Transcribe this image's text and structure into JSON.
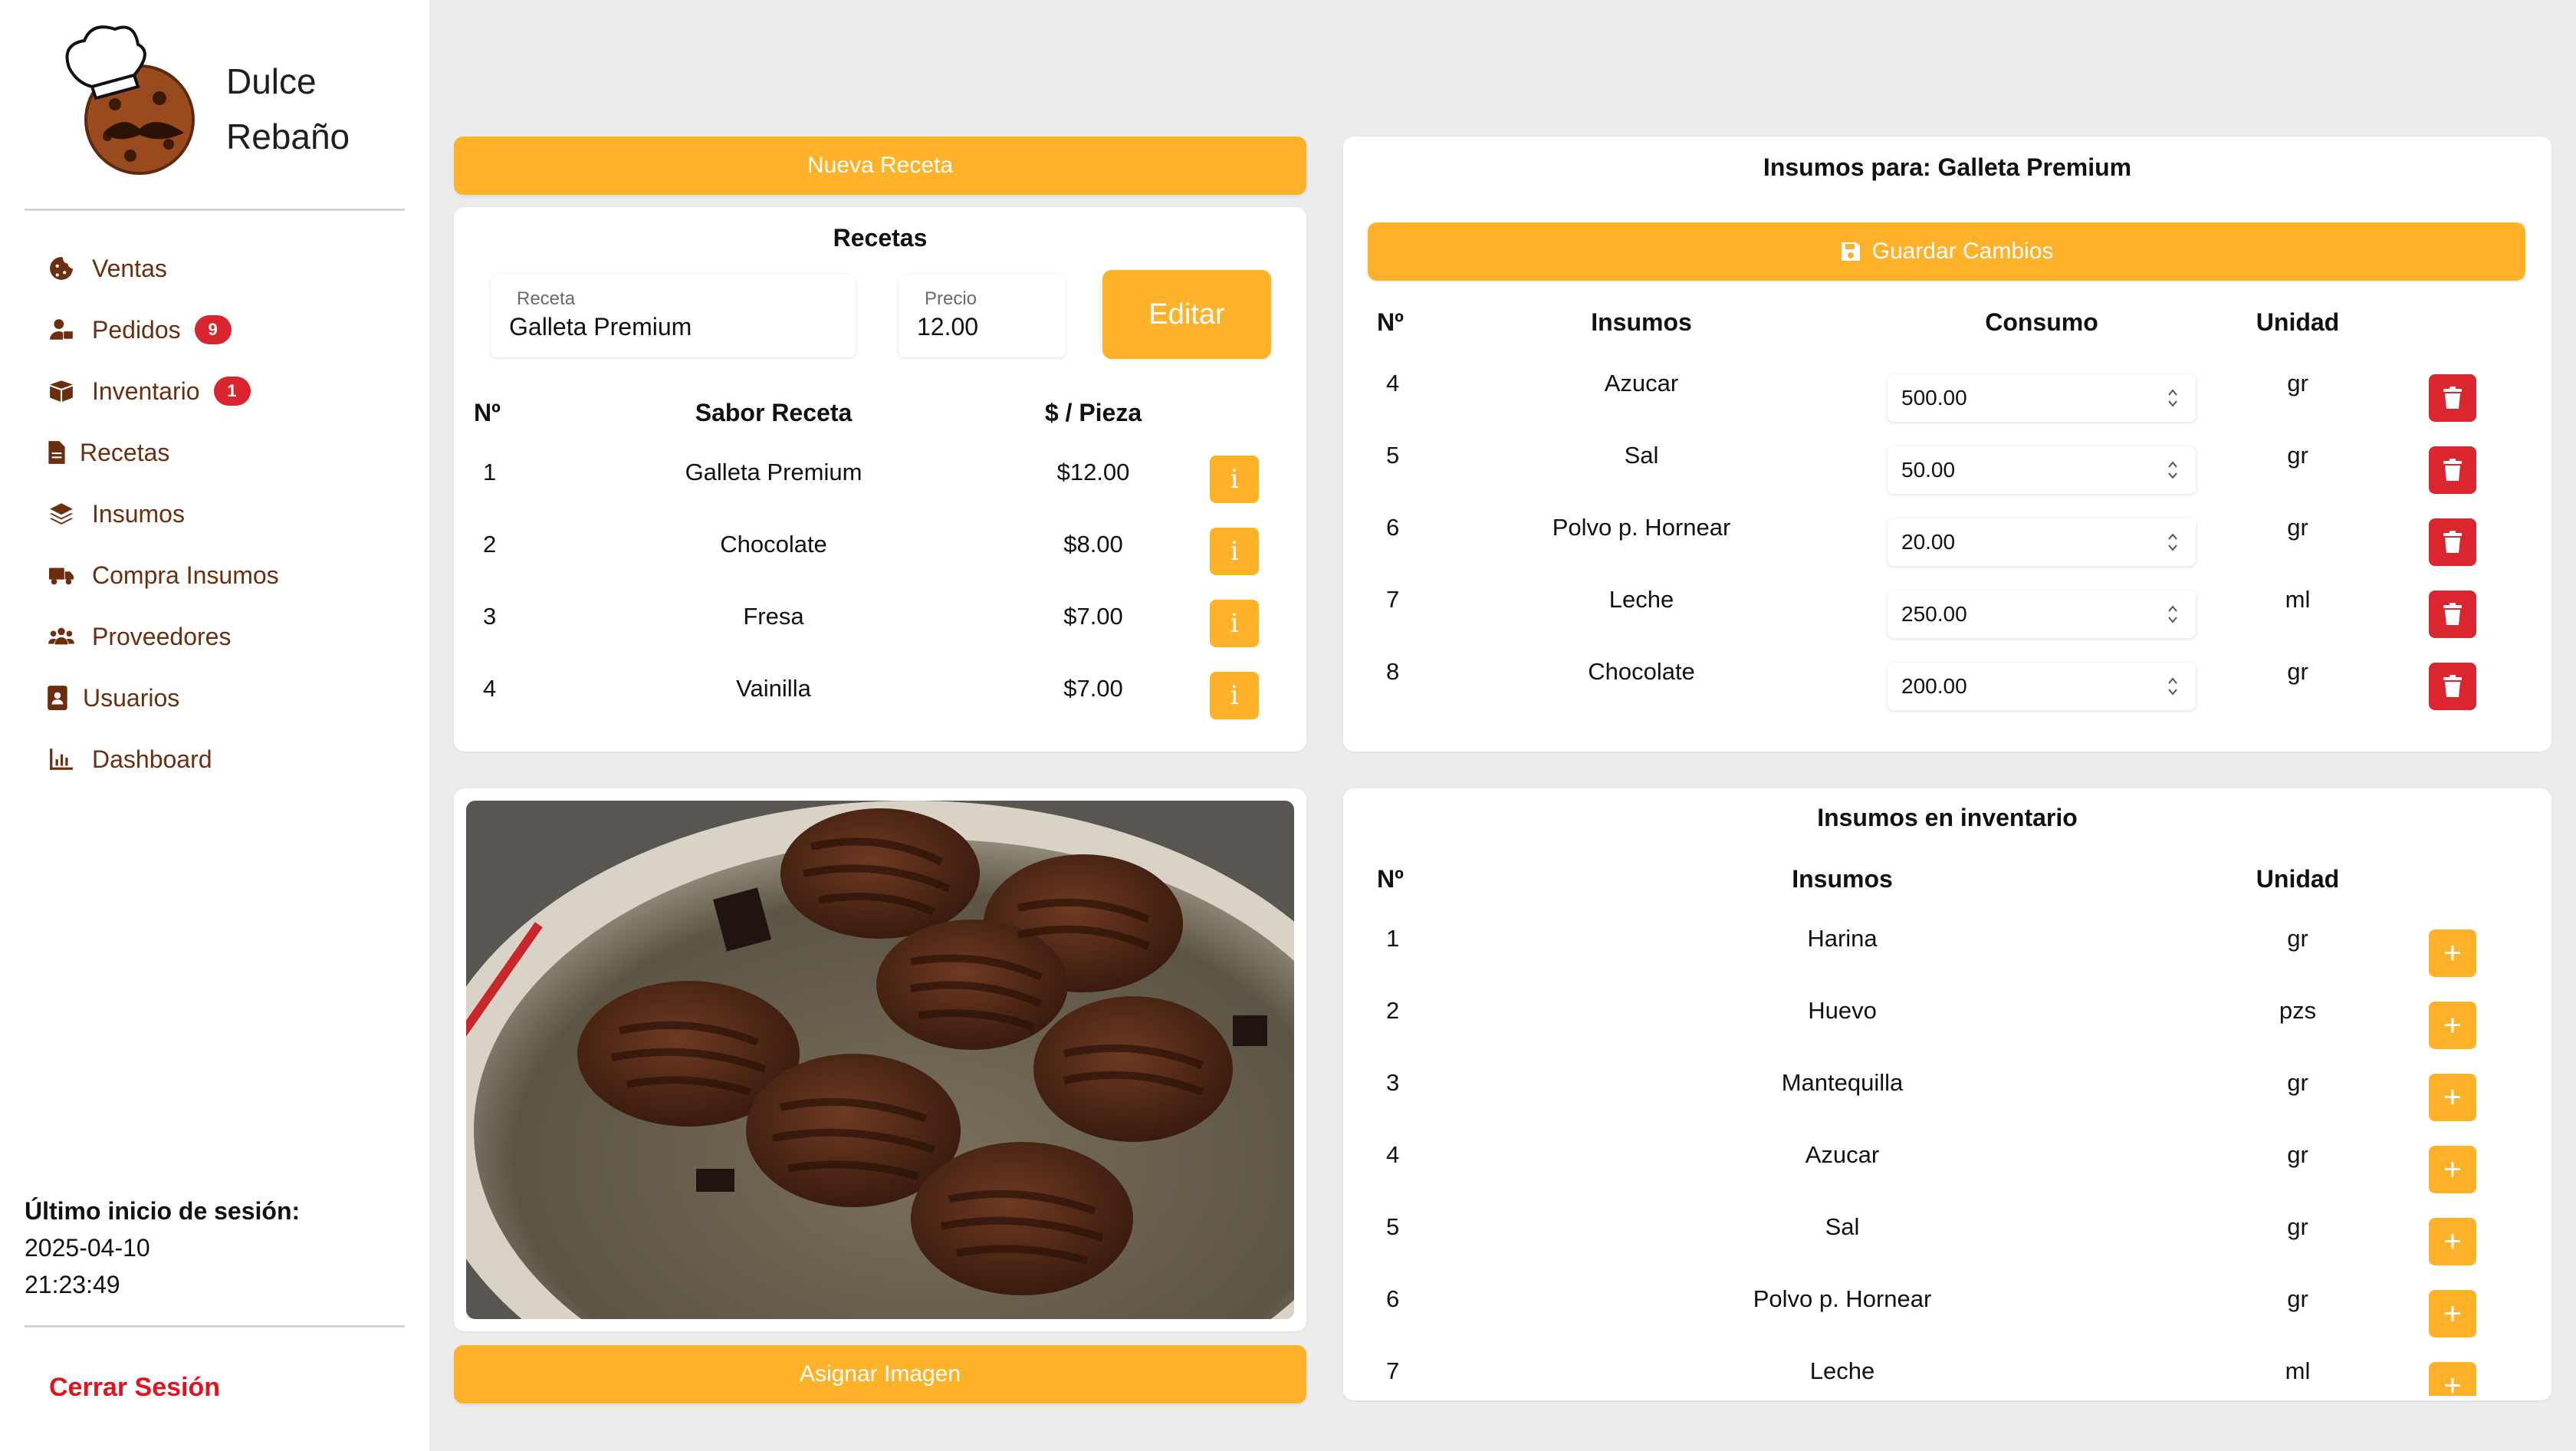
{
  "brand": {
    "line1": "Dulce",
    "line2": "Rebaño"
  },
  "nav": [
    {
      "label": "Ventas",
      "icon": "cookie-icon"
    },
    {
      "label": "Pedidos",
      "icon": "user-delivery-icon",
      "badge": "9"
    },
    {
      "label": "Inventario",
      "icon": "boxes-icon",
      "badge": "1"
    },
    {
      "label": "Recetas",
      "icon": "file-icon"
    },
    {
      "label": "Insumos",
      "icon": "layers-icon"
    },
    {
      "label": "Compra Insumos",
      "icon": "truck-icon"
    },
    {
      "label": "Proveedores",
      "icon": "users-icon"
    },
    {
      "label": "Usuarios",
      "icon": "address-book-icon"
    },
    {
      "label": "Dashboard",
      "icon": "chart-icon"
    }
  ],
  "session": {
    "label": "Último inicio de sesión:",
    "date": "2025-04-10",
    "time": "21:23:49"
  },
  "logout": "Cerrar Sesión",
  "recipes": {
    "new_button": "Nueva Receta",
    "title": "Recetas",
    "field_recipe_label": "Receta",
    "field_recipe_value": "Galleta Premium",
    "field_price_label": "Precio",
    "field_price_value": "12.00",
    "edit_button": "Editar",
    "headers": {
      "num": "Nº",
      "flavor": "Sabor Receta",
      "price": "$ / Pieza"
    },
    "rows": [
      {
        "num": "1",
        "flavor": "Galleta Premium",
        "price": "$12.00"
      },
      {
        "num": "2",
        "flavor": "Chocolate",
        "price": "$8.00"
      },
      {
        "num": "3",
        "flavor": "Fresa",
        "price": "$7.00"
      },
      {
        "num": "4",
        "flavor": "Vainilla",
        "price": "$7.00"
      }
    ],
    "info_label": "i"
  },
  "image_panel": {
    "assign_button": "Asignar Imagen"
  },
  "supplies_for": {
    "title": "Insumos para: Galleta Premium",
    "save_button": "Guardar Cambios",
    "headers": {
      "num": "Nº",
      "supply": "Insumos",
      "consumption": "Consumo",
      "unit": "Unidad"
    },
    "rows": [
      {
        "num": "4",
        "supply": "Azucar",
        "consumption": "500.00",
        "unit": "gr"
      },
      {
        "num": "5",
        "supply": "Sal",
        "consumption": "50.00",
        "unit": "gr"
      },
      {
        "num": "6",
        "supply": "Polvo p. Hornear",
        "consumption": "20.00",
        "unit": "gr"
      },
      {
        "num": "7",
        "supply": "Leche",
        "consumption": "250.00",
        "unit": "ml"
      },
      {
        "num": "8",
        "supply": "Chocolate",
        "consumption": "200.00",
        "unit": "gr"
      }
    ]
  },
  "inventory": {
    "title": "Insumos en inventario",
    "headers": {
      "num": "Nº",
      "supply": "Insumos",
      "unit": "Unidad"
    },
    "rows": [
      {
        "num": "1",
        "supply": "Harina",
        "unit": "gr"
      },
      {
        "num": "2",
        "supply": "Huevo",
        "unit": "pzs"
      },
      {
        "num": "3",
        "supply": "Mantequilla",
        "unit": "gr"
      },
      {
        "num": "4",
        "supply": "Azucar",
        "unit": "gr"
      },
      {
        "num": "5",
        "supply": "Sal",
        "unit": "gr"
      },
      {
        "num": "6",
        "supply": "Polvo p. Hornear",
        "unit": "gr"
      },
      {
        "num": "7",
        "supply": "Leche",
        "unit": "ml"
      }
    ],
    "add_label": "+"
  },
  "colors": {
    "accent": "#fdb22a",
    "danger": "#d9262f",
    "nav_text": "#6b2e0e",
    "logout": "#e0141e"
  }
}
